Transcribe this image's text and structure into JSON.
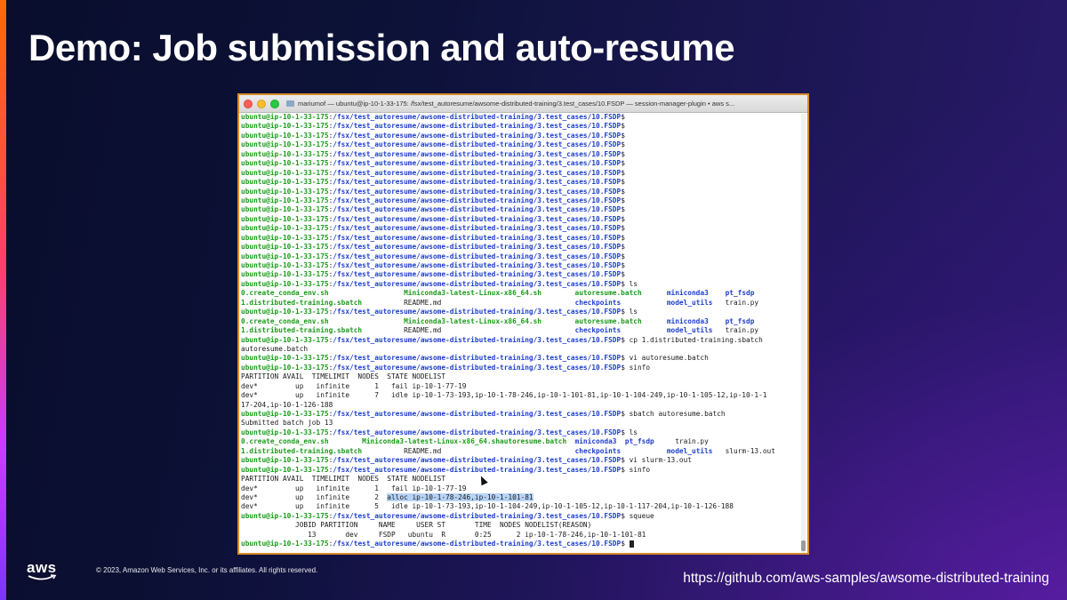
{
  "slide": {
    "title": "Demo: Job submission and auto-resume",
    "copyright": "© 2023, Amazon Web Services, Inc. or its affiliates. All rights reserved.",
    "url": "https://github.com/aws-samples/awsome-distributed-training",
    "logo_text": "aws"
  },
  "terminal": {
    "window_title": "mariumof — ubuntu@ip-10-1-33-175: /fsx/test_autoresume/awsome-distributed-training/3.test_cases/10.FSDP — session-manager-plugin • aws s...",
    "prompt_user": "ubuntu@ip-10-1-33-175",
    "prompt_path": "/fsx/test_autoresume/awsome-distributed-training/3.test_cases/10.FSDP",
    "lines": [
      {
        "type": "prompt",
        "cmd": ""
      },
      {
        "type": "prompt",
        "cmd": ""
      },
      {
        "type": "prompt",
        "cmd": ""
      },
      {
        "type": "prompt",
        "cmd": ""
      },
      {
        "type": "prompt",
        "cmd": ""
      },
      {
        "type": "prompt",
        "cmd": ""
      },
      {
        "type": "prompt",
        "cmd": ""
      },
      {
        "type": "prompt",
        "cmd": ""
      },
      {
        "type": "prompt",
        "cmd": ""
      },
      {
        "type": "prompt",
        "cmd": ""
      },
      {
        "type": "prompt",
        "cmd": ""
      },
      {
        "type": "prompt",
        "cmd": ""
      },
      {
        "type": "prompt",
        "cmd": ""
      },
      {
        "type": "prompt",
        "cmd": ""
      },
      {
        "type": "prompt",
        "cmd": ""
      },
      {
        "type": "prompt",
        "cmd": ""
      },
      {
        "type": "prompt",
        "cmd": ""
      },
      {
        "type": "prompt",
        "cmd": ""
      },
      {
        "type": "prompt",
        "cmd": " ls"
      },
      {
        "type": "ls",
        "cols": [
          [
            "0.create_conda_env.sh",
            "exec"
          ],
          [
            "Miniconda3-latest-Linux-x86_64.sh",
            "exec"
          ],
          [
            "autoresume.batch",
            "exec"
          ],
          [
            "miniconda3",
            "dir"
          ],
          [
            "pt_fsdp",
            "dir"
          ]
        ],
        "widths": [
          39,
          41,
          22,
          14,
          0
        ]
      },
      {
        "type": "ls",
        "cols": [
          [
            "1.distributed-training.sbatch",
            "exec"
          ],
          [
            "README.md",
            "plain"
          ],
          [
            "checkpoints",
            "dir"
          ],
          [
            "model_utils",
            "dir"
          ],
          [
            "train.py",
            "plain"
          ]
        ],
        "widths": [
          39,
          41,
          22,
          14,
          0
        ]
      },
      {
        "type": "prompt",
        "cmd": " ls"
      },
      {
        "type": "ls",
        "cols": [
          [
            "0.create_conda_env.sh",
            "exec"
          ],
          [
            "Miniconda3-latest-Linux-x86_64.sh",
            "exec"
          ],
          [
            "autoresume.batch",
            "exec"
          ],
          [
            "miniconda3",
            "dir"
          ],
          [
            "pt_fsdp",
            "dir"
          ]
        ],
        "widths": [
          39,
          41,
          22,
          14,
          0
        ]
      },
      {
        "type": "ls",
        "cols": [
          [
            "1.distributed-training.sbatch",
            "exec"
          ],
          [
            "README.md",
            "plain"
          ],
          [
            "checkpoints",
            "dir"
          ],
          [
            "model_utils",
            "dir"
          ],
          [
            "train.py",
            "plain"
          ]
        ],
        "widths": [
          39,
          41,
          22,
          14,
          0
        ]
      },
      {
        "type": "prompt",
        "cmd": " cp 1.distributed-training.sbatch"
      },
      {
        "type": "text",
        "text": "autoresume.batch"
      },
      {
        "type": "prompt",
        "cmd": " vi autoresume.batch"
      },
      {
        "type": "prompt",
        "cmd": " sinfo"
      },
      {
        "type": "text",
        "text": "PARTITION AVAIL  TIMELIMIT  NODES  STATE NODELIST"
      },
      {
        "type": "text",
        "text": "dev*         up   infinite      1   fail ip-10-1-77-19"
      },
      {
        "type": "text",
        "text": "dev*         up   infinite      7   idle ip-10-1-73-193,ip-10-1-78-246,ip-10-1-101-81,ip-10-1-104-249,ip-10-1-105-12,ip-10-1-1"
      },
      {
        "type": "text",
        "text": "17-204,ip-10-1-126-188"
      },
      {
        "type": "prompt",
        "cmd": " sbatch autoresume.batch"
      },
      {
        "type": "text",
        "text": "Submitted batch job 13"
      },
      {
        "type": "prompt",
        "cmd": " ls"
      },
      {
        "type": "ls",
        "cols": [
          [
            "0.create_conda_env.sh",
            "exec"
          ],
          [
            "Miniconda3-latest-Linux-x86_64.sh",
            "exec"
          ],
          [
            "autoresume.batch",
            "exec"
          ],
          [
            "miniconda3",
            "dir"
          ],
          [
            "pt_fsdp",
            "dir"
          ],
          [
            "train.py",
            "plain"
          ]
        ],
        "widths": [
          29,
          33,
          18,
          12,
          12,
          0
        ]
      },
      {
        "type": "ls",
        "cols": [
          [
            "1.distributed-training.sbatch",
            "exec"
          ],
          [
            "README.md",
            "plain"
          ],
          [
            "checkpoints",
            "dir"
          ],
          [
            "model_utils",
            "dir"
          ],
          [
            "slurm-13.out",
            "plain"
          ]
        ],
        "widths": [
          39,
          41,
          22,
          14,
          0
        ]
      },
      {
        "type": "prompt",
        "cmd": " vi slurm-13.out"
      },
      {
        "type": "prompt",
        "cmd": " sinfo"
      },
      {
        "type": "text",
        "text": "PARTITION AVAIL  TIMELIMIT  NODES  STATE NODELIST"
      },
      {
        "type": "text",
        "text": "dev*         up   infinite      1   fail ip-10-1-77-19"
      },
      {
        "type": "hltext",
        "pre": "dev*         up   infinite      2  ",
        "hl": "alloc ip-10-1-78-246,ip-10-1-101-81",
        "post": ""
      },
      {
        "type": "text",
        "text": "dev*         up   infinite      5   idle ip-10-1-73-193,ip-10-1-104-249,ip-10-1-105-12,ip-10-1-117-204,ip-10-1-126-188"
      },
      {
        "type": "prompt",
        "cmd": " squeue"
      },
      {
        "type": "text",
        "text": "             JOBID PARTITION     NAME     USER ST       TIME  NODES NODELIST(REASON)"
      },
      {
        "type": "text",
        "text": "                13       dev     FSDP   ubuntu  R       0:25      2 ip-10-1-78-246,ip-10-1-101-81"
      },
      {
        "type": "prompt",
        "cmd": " ",
        "cursor": true
      }
    ]
  },
  "colors": {
    "prompt_user": "#1a9c1a",
    "prompt_path": "#1f3fcc",
    "highlight": "#b7d4f7",
    "terminal_border": "#d88a2a"
  },
  "icons": {
    "close": "close-dot-icon",
    "minimize": "minimize-dot-icon",
    "zoom": "zoom-dot-icon",
    "folder": "folder-icon",
    "pointer": "mouse-pointer-icon"
  }
}
